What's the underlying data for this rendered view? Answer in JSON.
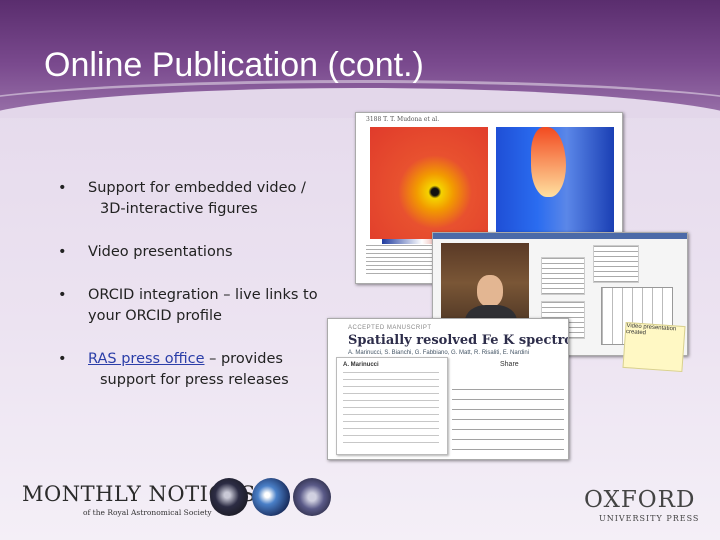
{
  "slide": {
    "title": "Online Publication (cont.)",
    "bullets": [
      {
        "lines": [
          "Support for embedded video /",
          "3D-interactive figures"
        ]
      },
      {
        "lines": [
          "Video presentations"
        ]
      },
      {
        "lines": [
          "ORCID integration – live links to",
          "your ORCID profile"
        ]
      },
      {
        "link_text": "RAS press office",
        "lines": [
          " – provides",
          "support for press releases"
        ]
      }
    ]
  },
  "screenshots": {
    "article_figure": {
      "header": "3188   T. T. Mudona et al."
    },
    "accepted_manuscript": {
      "label": "ACCEPTED MANUSCRIPT",
      "title": "Spatially resolved Fe K spectroscopy of",
      "authors": "A. Marinucci, S. Bianchi, G. Fabbiano, G. Matt, R. Risaliti, E. Nardini",
      "author_card_name": "A. Marinucci",
      "share": "Share"
    },
    "sticky_note": "Video presentation created"
  },
  "footer": {
    "journal_name": "MONTHLY NOTICES",
    "journal_sub": "of the Royal Astronomical Society",
    "publisher": "OXFORD",
    "publisher_sub": "UNIVERSITY PRESS"
  }
}
